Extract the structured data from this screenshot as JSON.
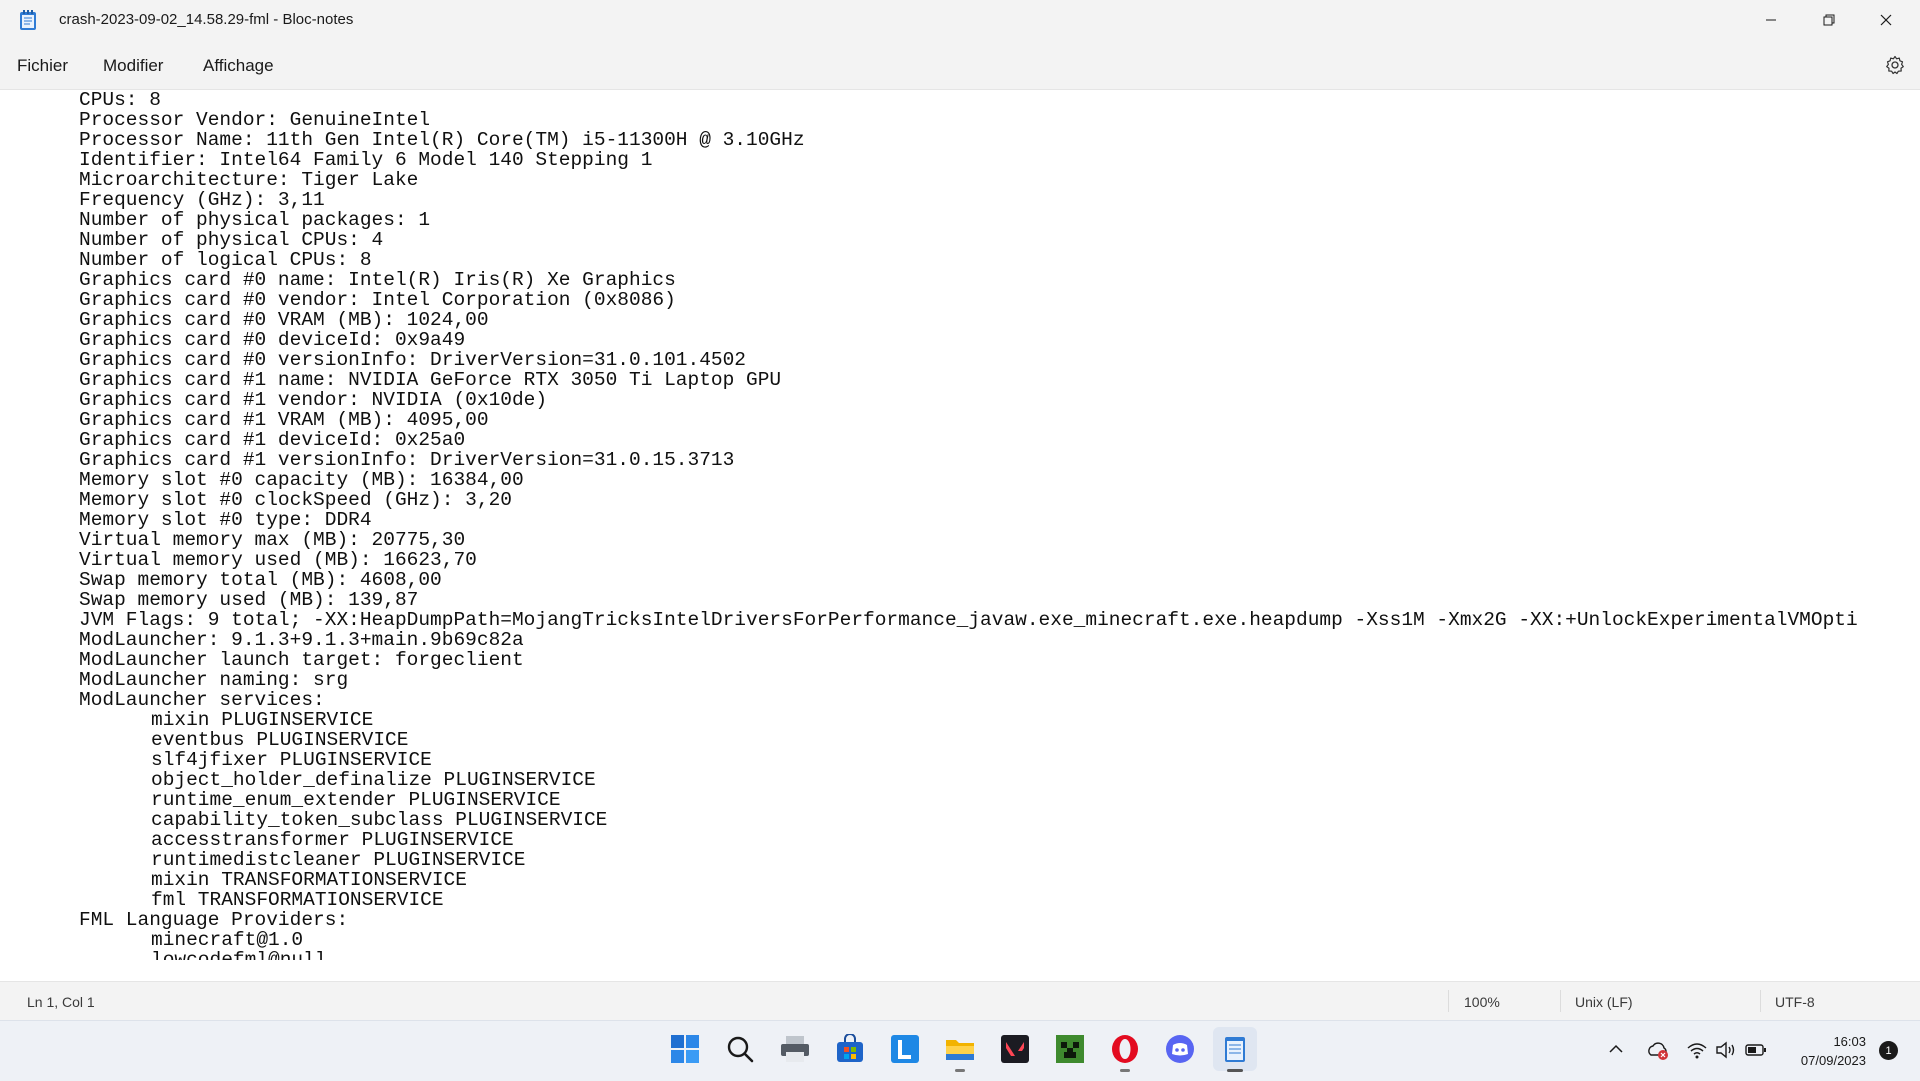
{
  "window": {
    "title": "crash-2023-09-02_14.58.29-fml - Bloc-notes",
    "minimize": "—",
    "maximize": "❐",
    "close": "✕"
  },
  "menu": {
    "items": [
      "Fichier",
      "Modifier",
      "Affichage"
    ]
  },
  "editor": {
    "lines": [
      "\tCPUs: 8",
      "\tProcessor Vendor: GenuineIntel",
      "\tProcessor Name: 11th Gen Intel(R) Core(TM) i5-11300H @ 3.10GHz",
      "\tIdentifier: Intel64 Family 6 Model 140 Stepping 1",
      "\tMicroarchitecture: Tiger Lake",
      "\tFrequency (GHz): 3,11",
      "\tNumber of physical packages: 1",
      "\tNumber of physical CPUs: 4",
      "\tNumber of logical CPUs: 8",
      "\tGraphics card #0 name: Intel(R) Iris(R) Xe Graphics",
      "\tGraphics card #0 vendor: Intel Corporation (0x8086)",
      "\tGraphics card #0 VRAM (MB): 1024,00",
      "\tGraphics card #0 deviceId: 0x9a49",
      "\tGraphics card #0 versionInfo: DriverVersion=31.0.101.4502",
      "\tGraphics card #1 name: NVIDIA GeForce RTX 3050 Ti Laptop GPU",
      "\tGraphics card #1 vendor: NVIDIA (0x10de)",
      "\tGraphics card #1 VRAM (MB): 4095,00",
      "\tGraphics card #1 deviceId: 0x25a0",
      "\tGraphics card #1 versionInfo: DriverVersion=31.0.15.3713",
      "\tMemory slot #0 capacity (MB): 16384,00",
      "\tMemory slot #0 clockSpeed (GHz): 3,20",
      "\tMemory slot #0 type: DDR4",
      "\tVirtual memory max (MB): 20775,30",
      "\tVirtual memory used (MB): 16623,70",
      "\tSwap memory total (MB): 4608,00",
      "\tSwap memory used (MB): 139,87",
      "\tJVM Flags: 9 total; -XX:HeapDumpPath=MojangTricksIntelDriversForPerformance_javaw.exe_minecraft.exe.heapdump -Xss1M -Xmx2G -XX:+UnlockExperimentalVMOpti",
      "\tModLauncher: 9.1.3+9.1.3+main.9b69c82a",
      "\tModLauncher launch target: forgeclient",
      "\tModLauncher naming: srg",
      "\tModLauncher services:",
      "\t\tmixin PLUGINSERVICE",
      "\t\teventbus PLUGINSERVICE",
      "\t\tslf4jfixer PLUGINSERVICE",
      "\t\tobject_holder_definalize PLUGINSERVICE",
      "\t\truntime_enum_extender PLUGINSERVICE",
      "\t\tcapability_token_subclass PLUGINSERVICE",
      "\t\taccesstransformer PLUGINSERVICE",
      "\t\truntimedistcleaner PLUGINSERVICE",
      "\t\tmixin TRANSFORMATIONSERVICE",
      "\t\tfml TRANSFORMATIONSERVICE",
      "\tFML Language Providers:",
      "\t\tminecraft@1.0",
      "\t\tlowcodefml@null"
    ]
  },
  "status": {
    "position": "Ln 1, Col 1",
    "zoom": "100%",
    "line_ending": "Unix (LF)",
    "encoding": "UTF-8"
  },
  "taskbar": {
    "apps": [
      "start-icon",
      "search-icon",
      "printer-icon",
      "store-icon",
      "l-app-icon",
      "file-explorer-icon",
      "valorant-icon",
      "minecraft-icon",
      "opera-icon",
      "discord-icon",
      "notepad-icon"
    ],
    "clock_time": "16:03",
    "clock_date": "07/09/2023",
    "notifications": "1"
  }
}
